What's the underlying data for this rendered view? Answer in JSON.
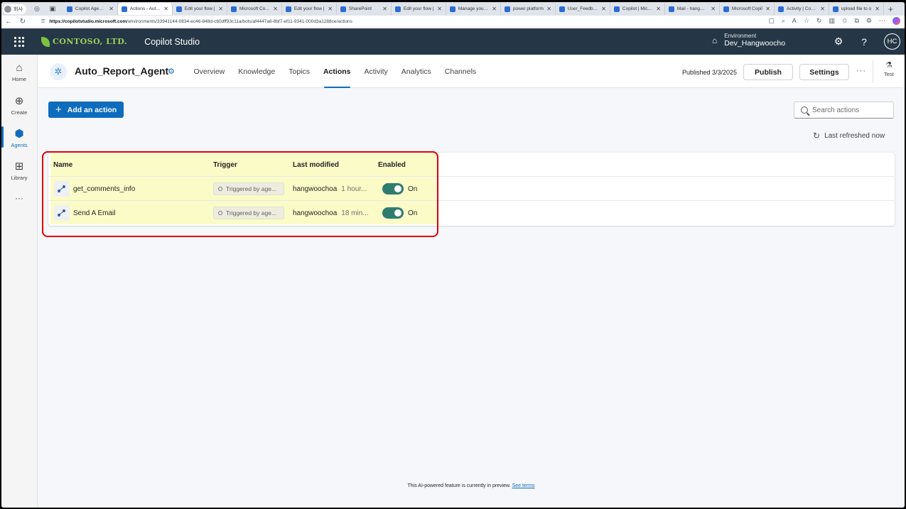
{
  "browser": {
    "profile_label": "회사",
    "tabs": [
      {
        "title": "Copilot Agent Su",
        "active": false
      },
      {
        "title": "Actions - Auto_",
        "active": true
      },
      {
        "title": "Edit your flow |",
        "active": false
      },
      {
        "title": "Microsoft Copilo",
        "active": false
      },
      {
        "title": "Edit your flow |",
        "active": false
      },
      {
        "title": "SharePoint",
        "active": false
      },
      {
        "title": "Edit your flow |",
        "active": false
      },
      {
        "title": "Manage your flo",
        "active": false
      },
      {
        "title": "power platform",
        "active": false
      },
      {
        "title": "User_Feedback",
        "active": false
      },
      {
        "title": "Copilot | Micros",
        "active": false
      },
      {
        "title": "Mail - hangwoo",
        "active": false
      },
      {
        "title": "Microsoft Copil",
        "active": false
      },
      {
        "title": "Activity | Conne",
        "active": false
      },
      {
        "title": "upload file to o",
        "active": false
      }
    ],
    "url_domain": "https://copilotstudio.microsoft.com",
    "url_path": "/environments/33941144-0834-ec46-848d-c60dff93c11a/bots/af4447a6-8bf7-ef11-9341-000d3a1288ce/actions"
  },
  "header": {
    "brand": "CONTOSO, LTD.",
    "product": "Copilot Studio",
    "environment_label": "Environment",
    "environment_value": "Dev_Hangwoocho",
    "avatar_initials": "HC"
  },
  "rail": {
    "items": [
      {
        "label": "Home",
        "icon": "home-icon"
      },
      {
        "label": "Create",
        "icon": "create-icon"
      },
      {
        "label": "Agents",
        "icon": "agents-icon",
        "active": true
      },
      {
        "label": "Library",
        "icon": "library-icon"
      }
    ]
  },
  "agent": {
    "name": "Auto_Report_Agent",
    "tabs": [
      "Overview",
      "Knowledge",
      "Topics",
      "Actions",
      "Activity",
      "Analytics",
      "Channels"
    ],
    "active_tab": "Actions",
    "published": "Published 3/3/2025",
    "publish_label": "Publish",
    "settings_label": "Settings",
    "test_label": "Test"
  },
  "actions": {
    "add_label": "Add an action",
    "search_placeholder": "Search actions",
    "refreshed_label": "Last refreshed now",
    "columns": {
      "name": "Name",
      "trigger": "Trigger",
      "modified": "Last modified",
      "enabled": "Enabled"
    },
    "rows": [
      {
        "name": "get_comments_info",
        "trigger": "Triggered by age...",
        "modified_by": "hangwoochoa",
        "modified_at": "1 hour...",
        "enabled": "On"
      },
      {
        "name": "Send A Email",
        "trigger": "Triggered by age...",
        "modified_by": "hangwoochoa",
        "modified_at": "18 min...",
        "enabled": "On"
      }
    ]
  },
  "footer": {
    "text": "This AI-powered feature is currently in preview.",
    "link": "See terms"
  },
  "colors": {
    "accent": "#0f6cbd",
    "header_bg": "#253746",
    "toggle_on": "#2e7d6f",
    "highlight": "#fbfbc7",
    "annotation_box": "#e00000"
  }
}
